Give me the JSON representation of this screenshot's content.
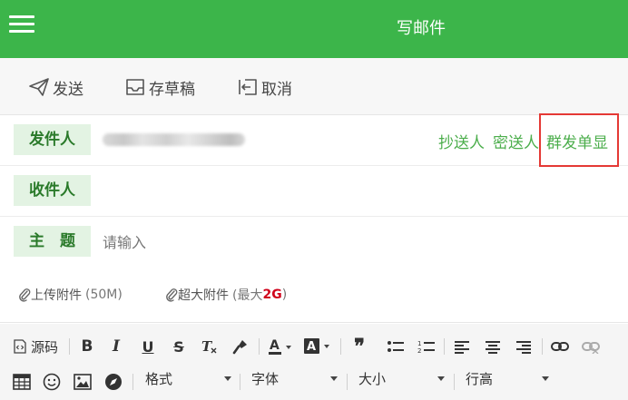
{
  "header": {
    "title": "写邮件",
    "menu_icon": "hamburger-icon",
    "bg_color": "#3cb54a"
  },
  "toolbar": {
    "send_label": "发送",
    "draft_label": "存草稿",
    "cancel_label": "取消"
  },
  "fields": {
    "sender_label": "发件人",
    "recipient_label": "收件人",
    "subject_label": "主　题",
    "subject_placeholder": "请输入",
    "cc_label": "抄送人",
    "bcc_label": "密送人",
    "separate_send_label": "群发单显"
  },
  "attachments": {
    "upload_label": "上传附件",
    "upload_limit": "(50M)",
    "large_label": "超大附件",
    "large_limit_prefix": "(最大 ",
    "large_limit_value": "2G",
    "large_limit_suffix": ")"
  },
  "editor": {
    "source_label": "源码",
    "format_label": "格式",
    "font_label": "字体",
    "size_label": "大小",
    "line_height_label": "行高"
  },
  "colors": {
    "accent": "#3cb54a",
    "link": "#4cae4c",
    "highlight": "#e53935",
    "danger": "#d0021b"
  }
}
